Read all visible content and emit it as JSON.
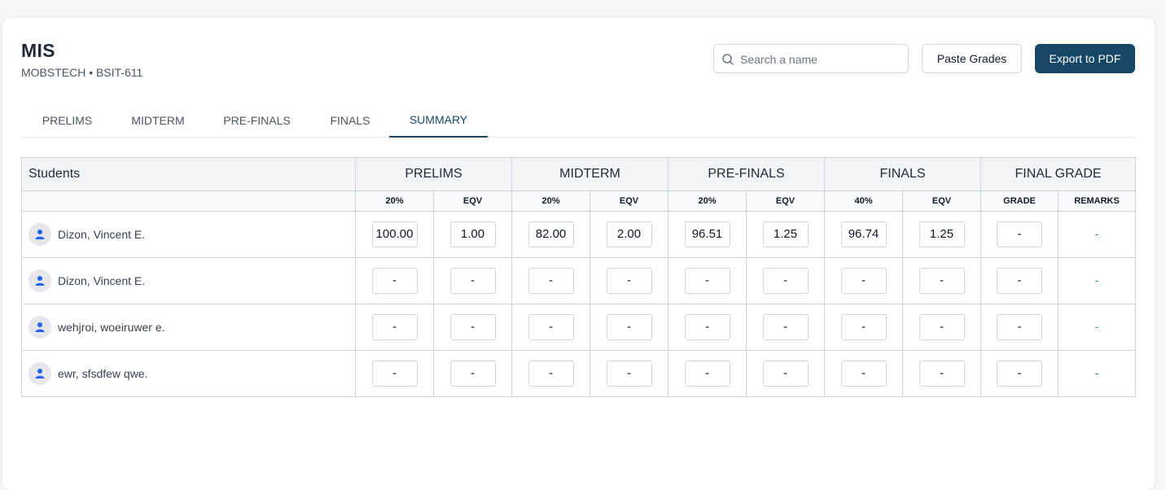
{
  "header": {
    "title": "MIS",
    "subtitle": "MOBSTECH • BSIT-611"
  },
  "search": {
    "placeholder": "Search a name",
    "value": ""
  },
  "buttons": {
    "paste": "Paste Grades",
    "export": "Export to PDF"
  },
  "tabs": [
    {
      "label": "PRELIMS",
      "active": false
    },
    {
      "label": "MIDTERM",
      "active": false
    },
    {
      "label": "PRE-FINALS",
      "active": false
    },
    {
      "label": "FINALS",
      "active": false
    },
    {
      "label": "SUMMARY",
      "active": true
    }
  ],
  "table": {
    "students_header": "Students",
    "groups": [
      "PRELIMS",
      "MIDTERM",
      "PRE-FINALS",
      "FINALS",
      "FINAL GRADE"
    ],
    "subheaders": [
      "20%",
      "EQV",
      "20%",
      "EQV",
      "20%",
      "EQV",
      "40%",
      "EQV",
      "GRADE",
      "REMARKS"
    ],
    "rows": [
      {
        "name": "Dizon, Vincent E.",
        "values": [
          "100.00",
          "1.00",
          "82.00",
          "2.00",
          "96.51",
          "1.25",
          "96.74",
          "1.25",
          "-"
        ],
        "remarks": "-"
      },
      {
        "name": "Dizon, Vincent E.",
        "values": [
          "-",
          "-",
          "-",
          "-",
          "-",
          "-",
          "-",
          "-",
          "-"
        ],
        "remarks": "-"
      },
      {
        "name": "wehjroi, woeiruwer e.",
        "values": [
          "-",
          "-",
          "-",
          "-",
          "-",
          "-",
          "-",
          "-",
          "-"
        ],
        "remarks": "-"
      },
      {
        "name": "ewr, sfsdfew qwe.",
        "values": [
          "-",
          "-",
          "-",
          "-",
          "-",
          "-",
          "-",
          "-",
          "-"
        ],
        "remarks": "-"
      }
    ]
  },
  "colors": {
    "accent": "#164866",
    "remarks": "#16a34a",
    "header_bg": "#f3f4f6",
    "border": "#d1d5db"
  }
}
